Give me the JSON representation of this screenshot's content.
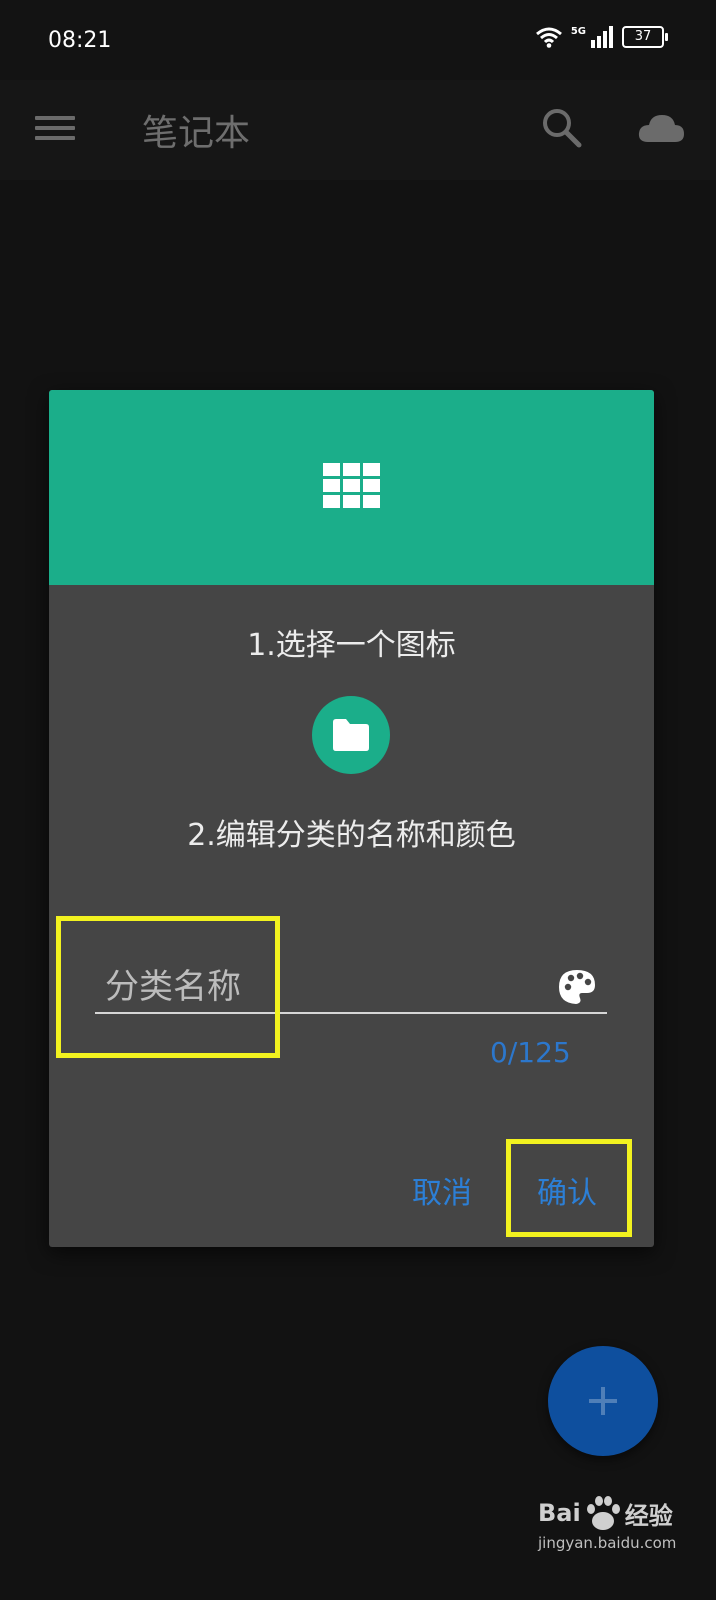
{
  "status_bar": {
    "time": "08:21",
    "network": "5G",
    "battery": "37"
  },
  "app_bar": {
    "title": "笔记本"
  },
  "dialog": {
    "step1": "1.选择一个图标",
    "step2": "2.编辑分类的名称和颜色",
    "input_value": "",
    "input_placeholder": "分类名称",
    "counter": "0/125",
    "cancel_label": "取消",
    "confirm_label": "确认"
  },
  "watermark": {
    "logo_left": "Bai",
    "logo_right": "经验",
    "subtitle": "jingyan.baidu.com"
  },
  "colors": {
    "accent_teal": "#1bae8a",
    "button_blue": "#2c7fd6",
    "fab_blue": "#0e4f9e",
    "highlight_yellow": "#f2f21f"
  },
  "icons": [
    "menu-icon",
    "search-icon",
    "cloud-icon",
    "grid-icon",
    "folder-icon",
    "palette-icon",
    "plus-icon",
    "wifi-icon",
    "signal-icon",
    "battery-icon"
  ]
}
